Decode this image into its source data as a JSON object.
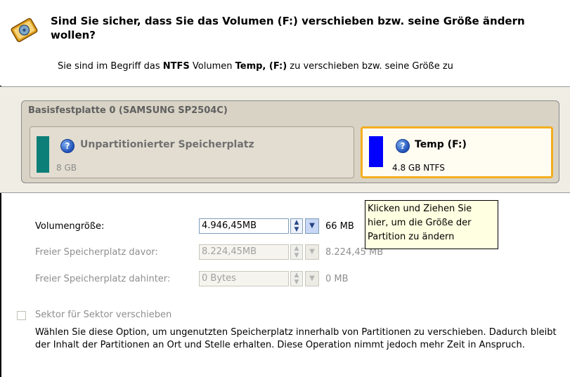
{
  "header": {
    "title": "Sind Sie sicher, dass Sie das Volumen (F:) verschieben bzw. seine Größe ändern wollen?",
    "subtitle_pre": "Sie sind im Begriff das ",
    "subtitle_fs": "NTFS",
    "subtitle_mid": " Volumen ",
    "subtitle_vol": "Temp, (F:)",
    "subtitle_post": " zu verschieben bzw. seine Größe zu",
    "icon": "wizard-drive-icon"
  },
  "disk": {
    "title": "Basisfestplatte 0 (SAMSUNG SP2504C)",
    "partitions": [
      {
        "name": "Unpartitionierter Speicherplatz",
        "size": "8 GB",
        "color": "#0c7f78",
        "selected": false
      },
      {
        "name": "Temp (F:)",
        "size": "4.8 GB NTFS",
        "color": "#0000ff",
        "selected": true
      }
    ]
  },
  "fields": {
    "volume_size": {
      "label": "Volumengröße:",
      "value": "4.946,45MB",
      "unit": "66 MB"
    },
    "free_before": {
      "label": "Freier Speicherplatz davor:",
      "value": "8.224,45MB",
      "unit": "8.224,45 MB"
    },
    "free_after": {
      "label": "Freier Speicherplatz dahinter:",
      "value": "0 Bytes",
      "unit": "0 MB"
    }
  },
  "tooltip": {
    "line1": "Klicken und Ziehen Sie",
    "line2": "hier, um die Größe der",
    "line3": "Partition zu ändern"
  },
  "option": {
    "label": "Sektor für Sektor verschieben",
    "checked": false,
    "description": "Wählen Sie diese Option, um ungenutzten Speicherplatz innerhalb von Partitionen zu verschieben. Dadurch bleibt der Inhalt der Partitionen an Ort und Stelle erhalten. Diese Operation nimmt jedoch mehr Zeit in Anspruch."
  },
  "colors": {
    "selected_border": "#f3ae1f",
    "tooltip_bg": "#ffffe1"
  }
}
